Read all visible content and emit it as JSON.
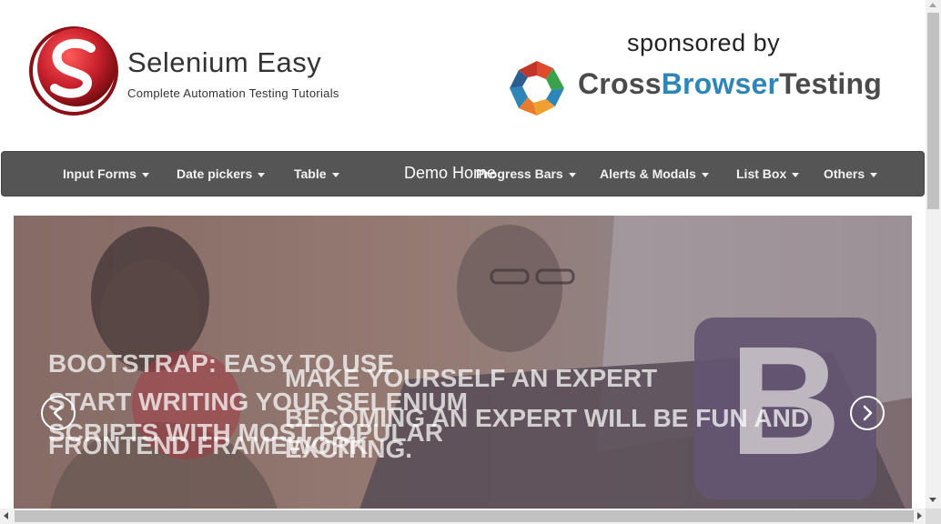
{
  "header": {
    "site_name": "Selenium Easy",
    "tagline": "Complete Automation Testing Tutorials",
    "sponsor_label": "sponsored by",
    "sponsor_name_part1": "Cross",
    "sponsor_name_part2": "Browser",
    "sponsor_name_part3": "Testing"
  },
  "nav": {
    "brand": "Demo Home",
    "items": [
      {
        "label": "Input Forms"
      },
      {
        "label": "Date pickers"
      },
      {
        "label": "Table"
      },
      {
        "label": "Progress Bars"
      },
      {
        "label": "Alerts & Modals"
      },
      {
        "label": "List Box"
      },
      {
        "label": "Others"
      }
    ]
  },
  "carousel": {
    "slide_texts": [
      "BOOTSTRAP: EASY TO USE",
      "MAKE YOURSELF AN EXPERT",
      "START WRITING YOUR SELENIUM SCRIPTS WITH MOST POPULAR",
      "BECOMING AN EXPERT WILL BE FUN AND EXCITING.",
      "FRONTEND FRAMEWORK"
    ]
  },
  "colors": {
    "navbar_bg": "#555555",
    "brand_red": "#c8202c",
    "cbt_blue": "#2e86b8",
    "cbt_gray": "#4b4b4b"
  },
  "icons": {
    "brand_logo": "selenium-easy-s-logo",
    "sponsor_logo": "crossbrowsertesting-logo",
    "carousel_prev": "chevron-left-icon",
    "carousel_next": "chevron-right-icon"
  }
}
